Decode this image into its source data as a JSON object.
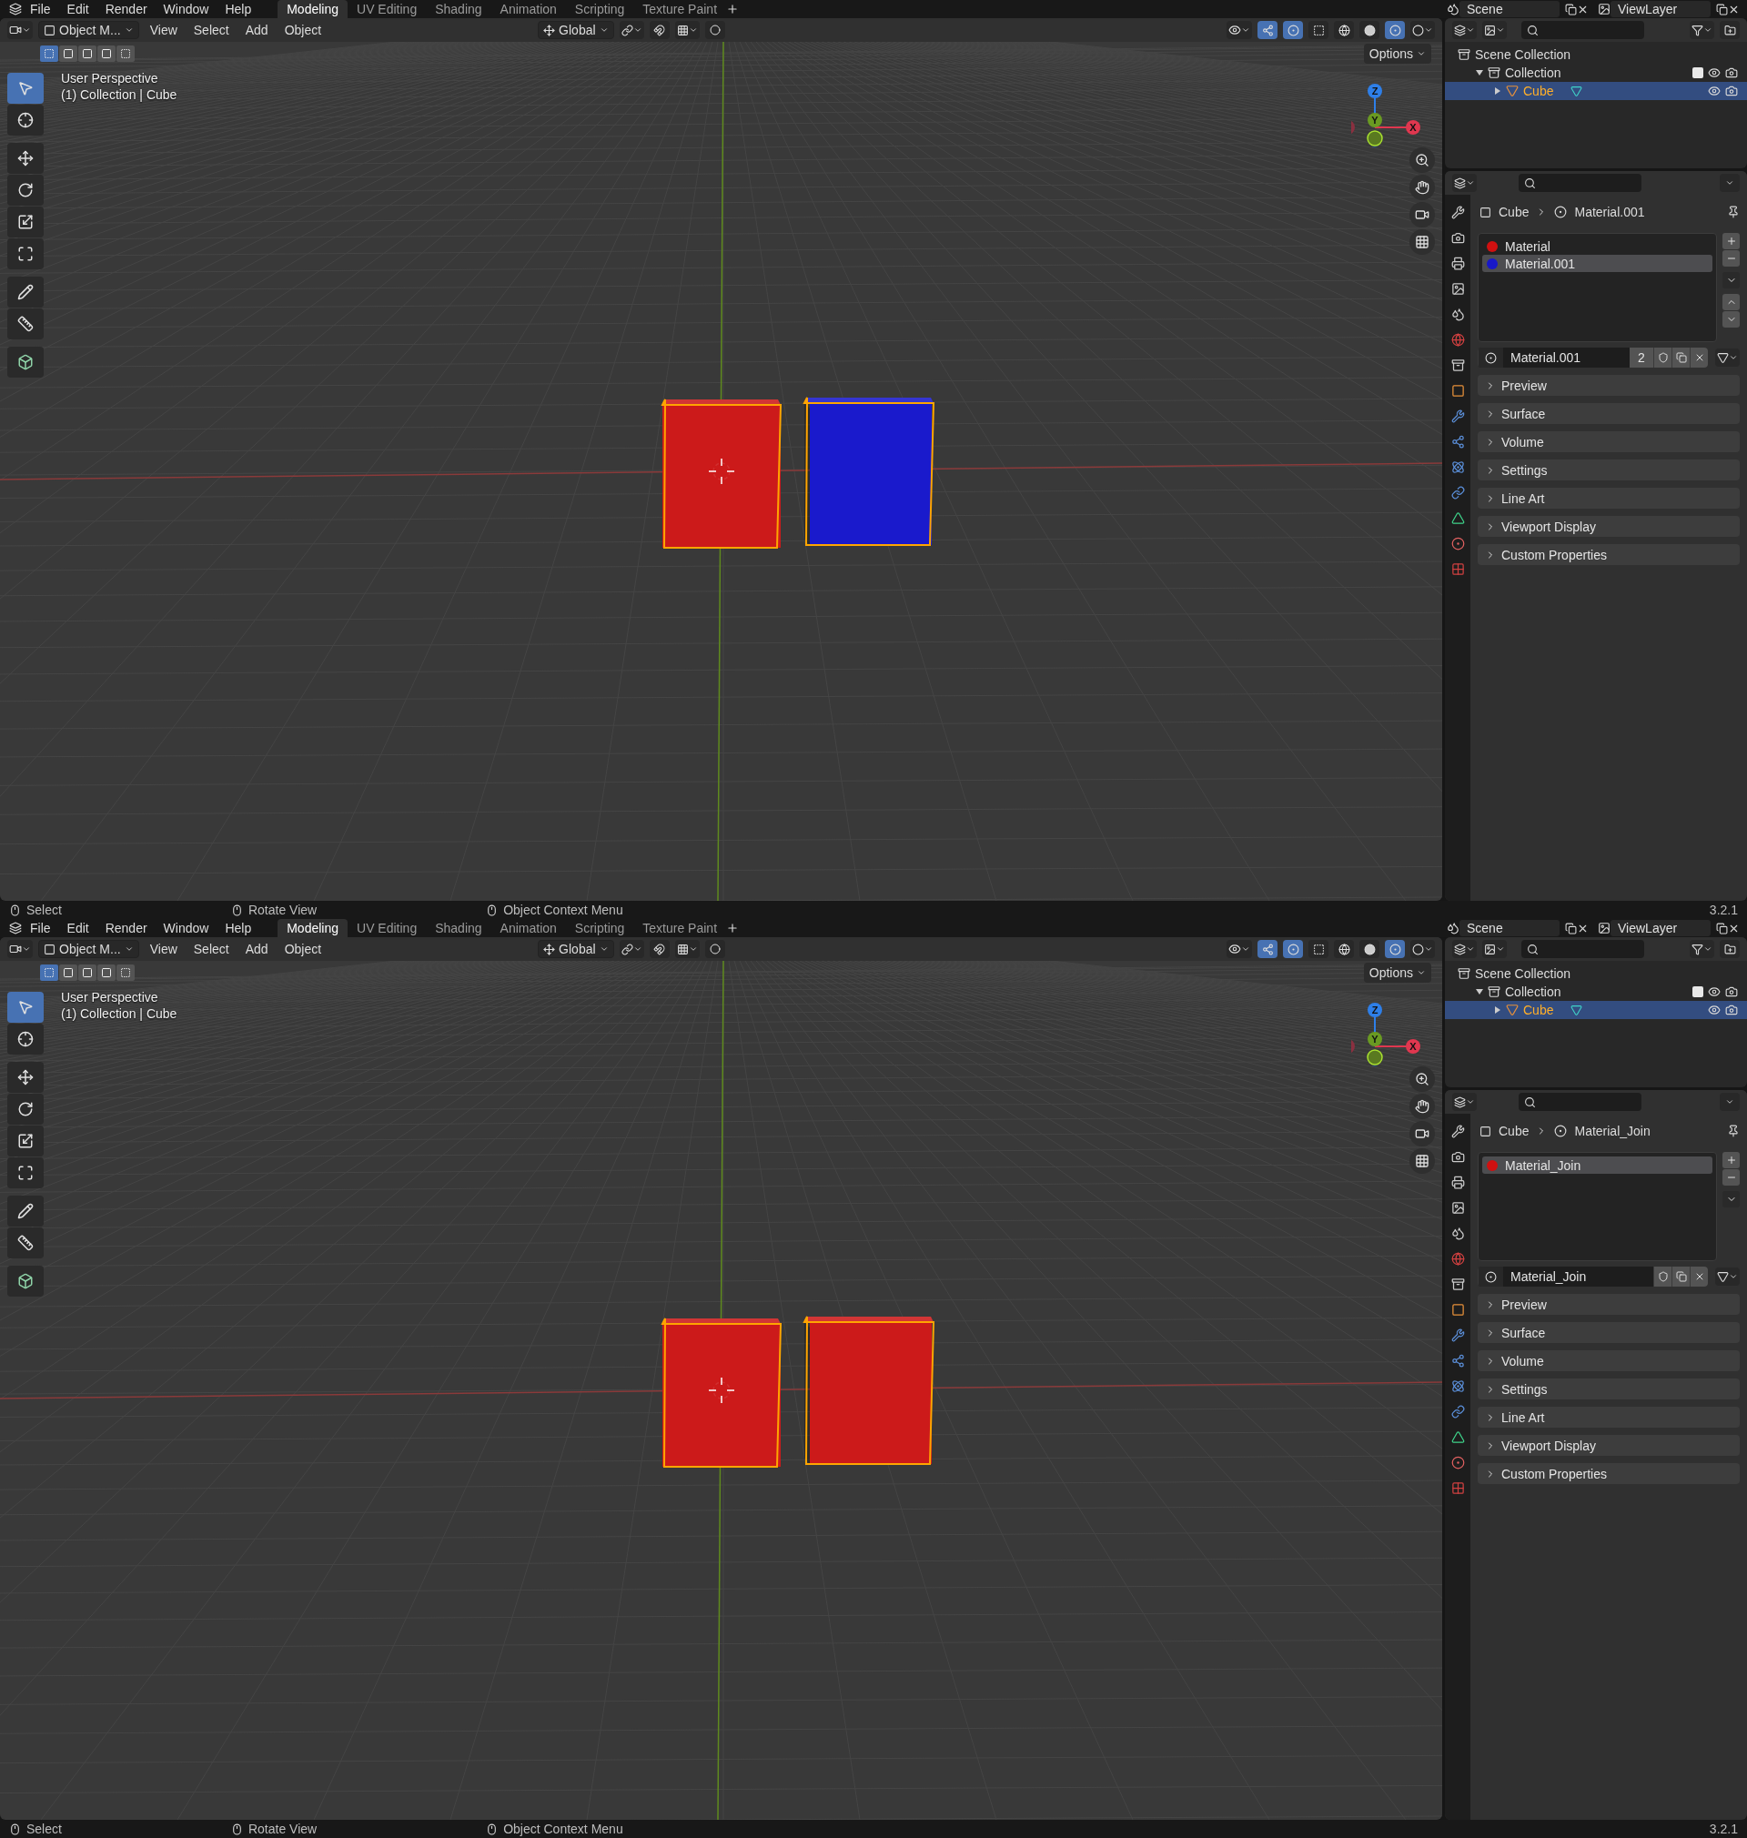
{
  "panes": [
    {
      "topbar": {
        "menus": [
          "File",
          "Edit",
          "Render",
          "Window",
          "Help"
        ],
        "workspaces": [
          {
            "label": "Modeling",
            "selected": true
          },
          {
            "label": "UV Editing",
            "selected": false
          },
          {
            "label": "Shading",
            "selected": false
          },
          {
            "label": "Animation",
            "selected": false
          },
          {
            "label": "Scripting",
            "selected": false
          },
          {
            "label": "Texture Paint",
            "selected": false
          }
        ],
        "scene": "Scene",
        "view_layer": "ViewLayer"
      },
      "header": {
        "mode": "Object M...",
        "menus": [
          "View",
          "Select",
          "Add",
          "Object"
        ],
        "orientation": "Global",
        "options": "Options"
      },
      "viewport": {
        "overlay": [
          "User Perspective",
          "(1) Collection | Cube"
        ],
        "axes": [
          {
            "label": "Z"
          },
          {
            "label": "Y"
          },
          {
            "label": "X"
          }
        ],
        "cubes": [
          {
            "color": "#cc1a1a"
          },
          {
            "color": "#1a1acc"
          }
        ]
      },
      "outliner": {
        "items": [
          {
            "label": "Scene Collection",
            "children": [
              {
                "label": "Collection",
                "expanded": true,
                "checked": true,
                "children": [
                  {
                    "label": "Cube",
                    "expanded": false,
                    "selected": true
                  }
                ]
              }
            ]
          }
        ]
      },
      "properties": {
        "object": "Cube",
        "material": "Material.001",
        "slots": [
          {
            "name": "Material",
            "color": "#d01010",
            "selected": false
          },
          {
            "name": "Material.001",
            "color": "#1818c8",
            "selected": true
          }
        ],
        "material_name": "Material.001",
        "users": "2",
        "panels": [
          "Preview",
          "Surface",
          "Volume",
          "Settings",
          "Line Art",
          "Viewport Display",
          "Custom Properties"
        ]
      },
      "status": {
        "items": [
          "Select",
          "Rotate View",
          "Object Context Menu"
        ],
        "version": "3.2.1"
      }
    },
    {
      "topbar": {
        "menus": [
          "File",
          "Edit",
          "Render",
          "Window",
          "Help"
        ],
        "workspaces": [
          {
            "label": "Modeling",
            "selected": true
          },
          {
            "label": "UV Editing",
            "selected": false
          },
          {
            "label": "Shading",
            "selected": false
          },
          {
            "label": "Animation",
            "selected": false
          },
          {
            "label": "Scripting",
            "selected": false
          },
          {
            "label": "Texture Paint",
            "selected": false
          }
        ],
        "scene": "Scene",
        "view_layer": "ViewLayer"
      },
      "header": {
        "mode": "Object M...",
        "menus": [
          "View",
          "Select",
          "Add",
          "Object"
        ],
        "orientation": "Global",
        "options": "Options"
      },
      "viewport": {
        "overlay": [
          "User Perspective",
          "(1) Collection | Cube"
        ],
        "axes": [
          {
            "label": "Z"
          },
          {
            "label": "Y"
          },
          {
            "label": "X"
          }
        ],
        "cubes": [
          {
            "color": "#cc1a1a"
          },
          {
            "color": "#cc1a1a"
          }
        ]
      },
      "outliner": {
        "items": [
          {
            "label": "Scene Collection",
            "children": [
              {
                "label": "Collection",
                "expanded": true,
                "checked": true,
                "children": [
                  {
                    "label": "Cube",
                    "expanded": false,
                    "selected": true
                  }
                ]
              }
            ]
          }
        ]
      },
      "properties": {
        "object": "Cube",
        "material": "Material_Join",
        "slots": [
          {
            "name": "Material_Join",
            "color": "#d01010",
            "selected": true
          }
        ],
        "material_name": "Material_Join",
        "panels": [
          "Preview",
          "Surface",
          "Volume",
          "Settings",
          "Line Art",
          "Viewport Display",
          "Custom Properties"
        ]
      },
      "status": {
        "items": [
          "Select",
          "Rotate View",
          "Object Context Menu"
        ],
        "version": "3.2.1"
      }
    }
  ]
}
